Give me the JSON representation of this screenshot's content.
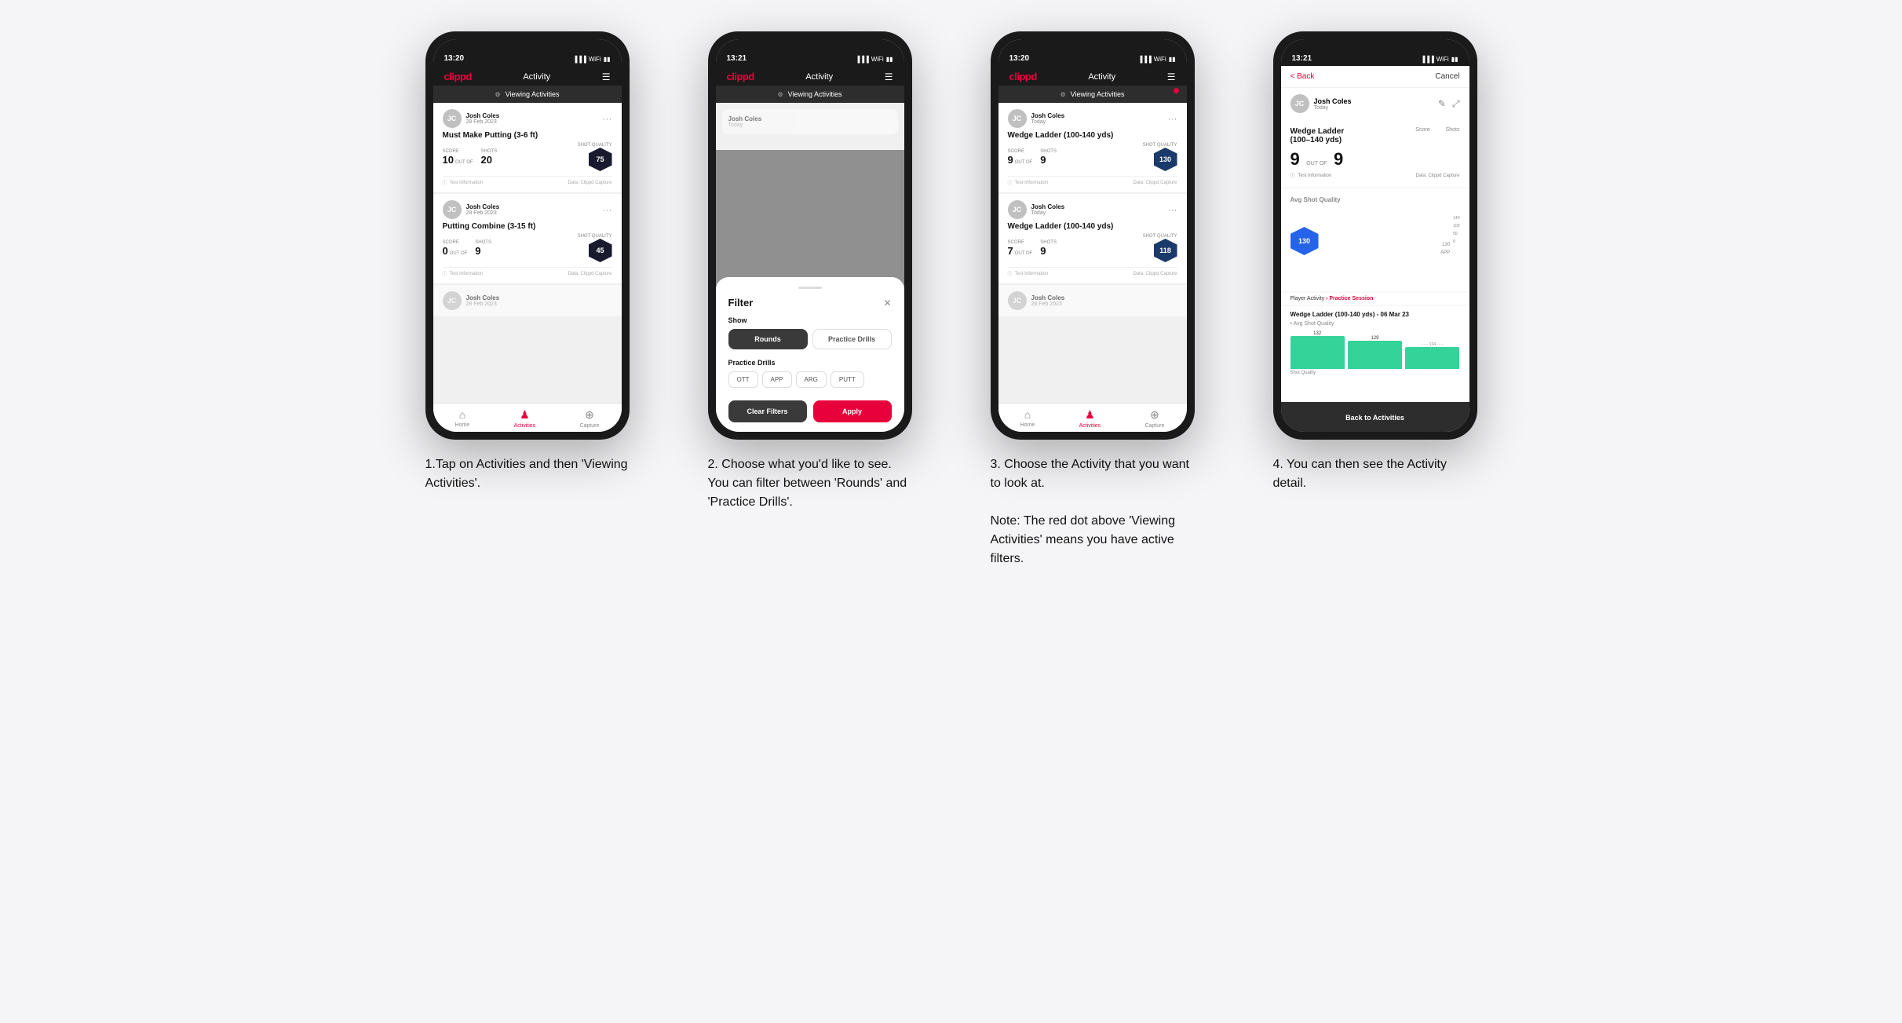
{
  "steps": [
    {
      "id": 1,
      "phone": {
        "time": "13:20",
        "logo": "clippd",
        "nav_title": "Activity",
        "viewing_label": "Viewing Activities",
        "has_red_dot": false,
        "cards": [
          {
            "user_name": "Josh Coles",
            "user_date": "28 Feb 2023",
            "title": "Must Make Putting (3-6 ft)",
            "score_label": "Score",
            "shots_label": "Shots",
            "shot_quality_label": "Shot Quality",
            "score": "10",
            "out_of_label": "OUT OF",
            "shots": "20",
            "shot_quality": "75",
            "footer_left": "Test Information",
            "footer_right": "Data: Clippd Capture"
          },
          {
            "user_name": "Josh Coles",
            "user_date": "28 Feb 2023",
            "title": "Putting Combine (3-15 ft)",
            "score_label": "Score",
            "shots_label": "Shots",
            "shot_quality_label": "Shot Quality",
            "score": "0",
            "out_of_label": "OUT OF",
            "shots": "9",
            "shot_quality": "45",
            "footer_left": "Test Information",
            "footer_right": "Data: Clippd Capture"
          }
        ],
        "bottom_nav": [
          "Home",
          "Activities",
          "Capture"
        ],
        "active_nav": 1
      },
      "description": "1.Tap on Activities and then 'Viewing Activities'."
    },
    {
      "id": 2,
      "phone": {
        "time": "13:21",
        "logo": "clippd",
        "nav_title": "Activity",
        "viewing_label": "Viewing Activities",
        "has_red_dot": false,
        "filter": {
          "title": "Filter",
          "show_label": "Show",
          "rounds_label": "Rounds",
          "practice_drills_label": "Practice Drills",
          "practice_drills_section": "Practice Drills",
          "chips": [
            "OTT",
            "APP",
            "ARG",
            "PUTT"
          ],
          "clear_label": "Clear Filters",
          "apply_label": "Apply"
        }
      },
      "description": "2. Choose what you'd like to see. You can filter between 'Rounds' and 'Practice Drills'."
    },
    {
      "id": 3,
      "phone": {
        "time": "13:20",
        "logo": "clippd",
        "nav_title": "Activity",
        "viewing_label": "Viewing Activities",
        "has_red_dot": true,
        "cards": [
          {
            "user_name": "Josh Coles",
            "user_date": "Today",
            "title": "Wedge Ladder (100-140 yds)",
            "score_label": "Score",
            "shots_label": "Shots",
            "shot_quality_label": "Shot Quality",
            "score": "9",
            "out_of_label": "OUT OF",
            "shots": "9",
            "shot_quality": "130",
            "footer_left": "Test Information",
            "footer_right": "Data: Clippd Capture"
          },
          {
            "user_name": "Josh Coles",
            "user_date": "Today",
            "title": "Wedge Ladder (100-140 yds)",
            "score_label": "Score",
            "shots_label": "Shots",
            "shot_quality_label": "Shot Quality",
            "score": "7",
            "out_of_label": "OUT OF",
            "shots": "9",
            "shot_quality": "118",
            "footer_left": "Test Information",
            "footer_right": "Data: Clippd Capture"
          },
          {
            "user_name": "Josh Coles",
            "user_date": "28 Feb 2023",
            "title": "",
            "partial": true
          }
        ],
        "bottom_nav": [
          "Home",
          "Activities",
          "Capture"
        ],
        "active_nav": 1
      },
      "description": "3. Choose the Activity that you want to look at.\n\nNote: The red dot above 'Viewing Activities' means you have active filters."
    },
    {
      "id": 4,
      "phone": {
        "time": "13:21",
        "logo": "clippd",
        "back_label": "< Back",
        "cancel_label": "Cancel",
        "user_name": "Josh Coles",
        "user_date": "Today",
        "drill_title": "Wedge Ladder\n(100-140 yds)",
        "score_label": "Score",
        "shots_label": "Shots",
        "score_value": "9",
        "out_of_label": "OUT OF",
        "shots_value": "9",
        "avg_shot_quality_label": "Avg Shot Quality",
        "shot_quality_value": "130",
        "bar_values": [
          132,
          129,
          124
        ],
        "bar_label": "APP",
        "y_labels": [
          "140",
          "100",
          "50",
          "0"
        ],
        "practice_session_label": "Player Activity",
        "practice_session_sub": "Practice Session",
        "detail_title": "Wedge Ladder (100-140 yds) - 06 Mar 23",
        "detail_chart_label": "• Avg Shot Quality",
        "back_activities_label": "Back to Activities"
      },
      "description": "4. You can then see the Activity detail."
    }
  ]
}
